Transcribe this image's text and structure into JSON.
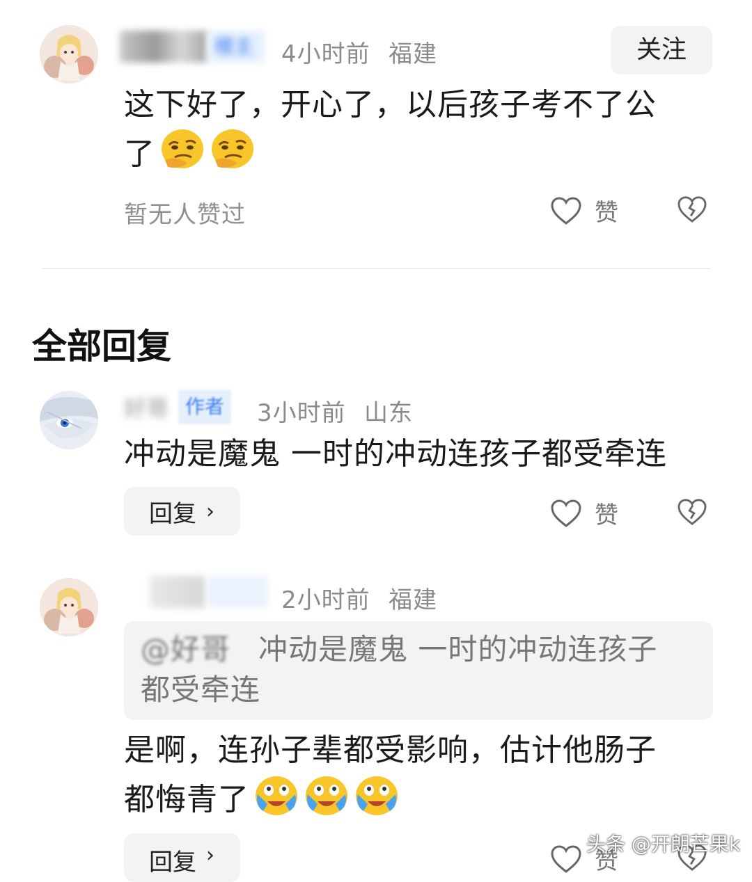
{
  "main_comment": {
    "badge": "楼主",
    "time": "4小时前",
    "location": "福建",
    "follow_label": "关注",
    "text_line1": "这下好了，开心了，以后孩子考不了公",
    "text_line2": "了",
    "likes_status": "暂无人赞过",
    "like_label": "赞",
    "emojis": [
      "smirk-emoji",
      "smirk-emoji"
    ]
  },
  "replies_section": {
    "title": "全部回复"
  },
  "replies": [
    {
      "name": "好哥",
      "badge": "作者",
      "time": "3小时前",
      "location": "山东",
      "text": "冲动是魔鬼 一时的冲动连孩子都受牵连",
      "reply_label": "回复",
      "like_label": "赞"
    },
    {
      "time": "2小时前",
      "location": "福建",
      "quote_mention": "@好哥",
      "quote_text_line1": "冲动是魔鬼 一时的冲动连孩子",
      "quote_text_line2": "都受牵连",
      "text_line1": "是啊，连孙子辈都受影响，估计他肠子",
      "text_line2": "都悔青了",
      "emojis": [
        "crying-laughing-emoji",
        "crying-laughing-emoji",
        "crying-laughing-emoji"
      ],
      "reply_label": "回复",
      "like_label": "赞"
    }
  ],
  "watermark": "头条 @开朗芒果k",
  "colors": {
    "badge_bg": "#e6f0fd",
    "badge_text": "#3d7ef0",
    "meta_gray": "#8a8a8a",
    "button_bg": "#f2f3f5"
  }
}
